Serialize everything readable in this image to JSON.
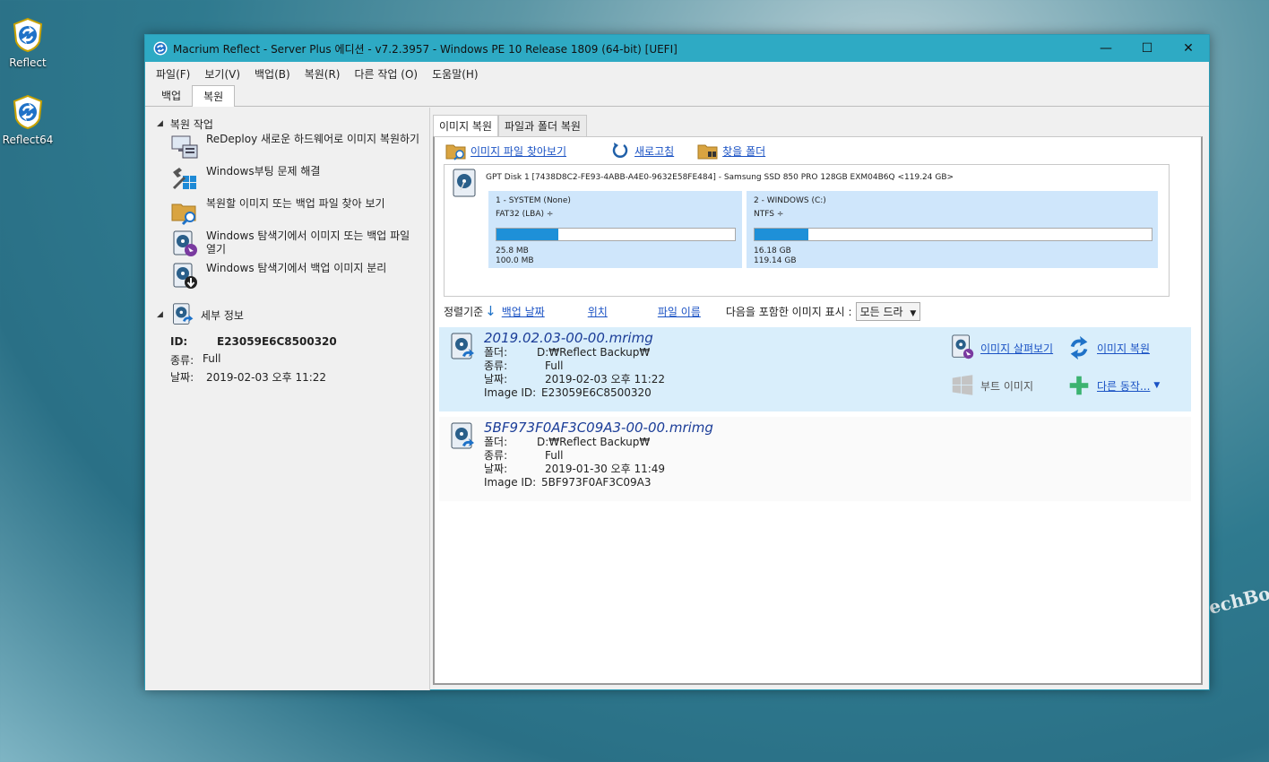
{
  "desktop": {
    "icons": [
      {
        "label": "Reflect"
      },
      {
        "label": "Reflect64"
      }
    ],
    "watermark": "echBoo"
  },
  "window": {
    "title": "Macrium Reflect - Server Plus 에디션 - v7.2.3957 - Windows PE 10 Release 1809 (64-bit)  [UEFI]",
    "controls": {
      "minimize": "—",
      "maximize": "☐",
      "close": "✕"
    }
  },
  "menu": [
    "파일(F)",
    "보기(V)",
    "백업(B)",
    "복원(R)",
    "다른 작업 (O)",
    "도움말(H)"
  ],
  "ribbon_tabs": [
    {
      "label": "백업",
      "active": false
    },
    {
      "label": "복원",
      "active": true
    }
  ],
  "left": {
    "tasks_header": "복원 작업",
    "tasks": [
      {
        "label": "ReDeploy 새로운 하드웨어로 이미지 복원하기",
        "icon": "redeploy-icon"
      },
      {
        "label": "Windows부팅 문제 해결",
        "icon": "windows-fix-icon"
      },
      {
        "label": "복원할 이미지 또는 백업 파일 찾아 보기",
        "icon": "browse-folder-icon"
      },
      {
        "label": "Windows 탐색기에서 이미지 또는 백업 파일 열기",
        "icon": "explore-image-icon"
      },
      {
        "label": "Windows 탐색기에서 백업 이미지 분리",
        "icon": "detach-image-icon"
      }
    ],
    "details_header": "세부 정보",
    "details": {
      "id_label": "ID:",
      "id_value": "E23059E6C8500320",
      "type_label": "종류:",
      "type_value": "Full",
      "date_label": "날짜:",
      "date_value": "2019-02-03 오후 11:22"
    }
  },
  "right": {
    "tabs": [
      {
        "label": "이미지 복원",
        "active": true
      },
      {
        "label": "파일과 폴더 복원",
        "active": false
      }
    ],
    "toolbar": {
      "browse": "이미지 파일 찾아보기",
      "refresh": "새로고침",
      "search_folder": "찾을 폴더"
    },
    "disk": {
      "label": "GPT Disk 1 [7438D8C2-FE93-4ABB-A4E0-9632E58FE484] - Samsung SSD 850 PRO 128GB EXM04B6Q  <119.24 GB>",
      "partitions": [
        {
          "name": "1 - SYSTEM (None)",
          "fs": "FAT32 (LBA) ÷",
          "used": "25.8 MB",
          "total": "100.0 MB",
          "fill_percent": 25.8
        },
        {
          "name": "2 - WINDOWS (C:)",
          "fs": "NTFS ÷",
          "used": "16.18 GB",
          "total": "119.14 GB",
          "fill_percent": 13.6
        }
      ]
    },
    "sort": {
      "label": "정렬기준",
      "by_date": "백업 날짜",
      "by_location": "위치",
      "by_filename": "파일 이름",
      "show_label": "다음을 포함한 이미지 표시 :",
      "dropdown_value": "모든 드라"
    },
    "images": [
      {
        "filename": "2019.02.03-00-00.mrimg",
        "folder_label": "폴더:",
        "folder": "D:₩Reflect Backup₩",
        "type_label": "종류:",
        "type": "Full",
        "date_label": "날짜:",
        "date": "2019-02-03 오후 11:22",
        "id_label": "Image ID:",
        "id": "E23059E6C8500320",
        "selected": true
      },
      {
        "filename": "5BF973F0AF3C09A3-00-00.mrimg",
        "folder_label": "폴더:",
        "folder": "D:₩Reflect Backup₩",
        "type_label": "종류:",
        "type": "Full",
        "date_label": "날짜:",
        "date": "2019-01-30 오후 11:49",
        "id_label": "Image ID:",
        "id": "5BF973F0AF3C09A3",
        "selected": false
      }
    ],
    "actions": {
      "explore": "이미지 살펴보기",
      "restore": "이미지 복원",
      "boot": "부트 이미지",
      "other": "다른 동작..."
    }
  },
  "colors": {
    "titlebar": "#2eaac4",
    "link": "#1a52c4",
    "selected_row": "#d9eefb",
    "partition_bg": "#cfe6fb",
    "bar_fill": "#1e90d8"
  }
}
